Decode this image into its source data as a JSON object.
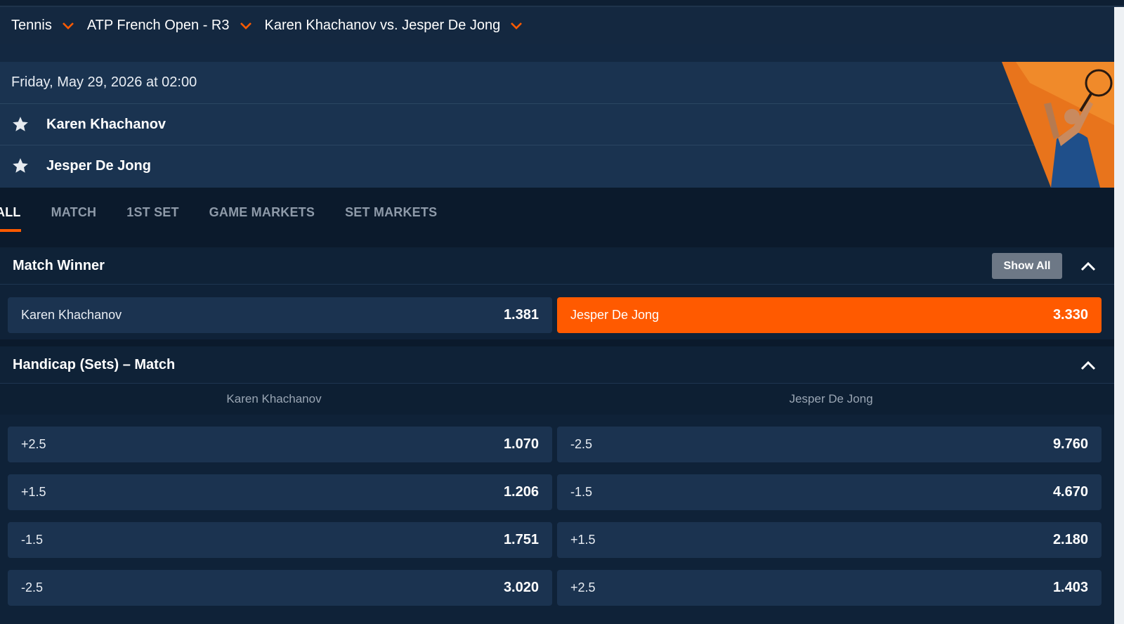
{
  "breadcrumbs": [
    {
      "label": "Tennis"
    },
    {
      "label": "ATP French Open - R3"
    },
    {
      "label": "Karen Khachanov vs. Jesper De Jong"
    }
  ],
  "event": {
    "date": "Friday, May 29, 2026 at 02:00",
    "team1": "Karen Khachanov",
    "team2": "Jesper De Jong"
  },
  "tabs": [
    "ALL",
    "MATCH",
    "1ST SET",
    "GAME MARKETS",
    "SET MARKETS"
  ],
  "match_winner": {
    "title": "Match Winner",
    "show_all": "Show All",
    "options": [
      {
        "label": "Karen Khachanov",
        "odds": "1.381"
      },
      {
        "label": "Jesper De Jong",
        "odds": "3.330"
      }
    ]
  },
  "handicap": {
    "title": "Handicap (Sets) – Match",
    "col1": "Karen Khachanov",
    "col2": "Jesper De Jong",
    "rows": [
      {
        "left_label": "+2.5",
        "left_odds": "1.070",
        "right_label": "-2.5",
        "right_odds": "9.760"
      },
      {
        "left_label": "+1.5",
        "left_odds": "1.206",
        "right_label": "-1.5",
        "right_odds": "4.670"
      },
      {
        "left_label": "-1.5",
        "left_odds": "1.751",
        "right_label": "+1.5",
        "right_odds": "2.180"
      },
      {
        "left_label": "-2.5",
        "left_odds": "3.020",
        "right_label": "+2.5",
        "right_odds": "1.403"
      }
    ]
  },
  "colors": {
    "accent": "#ff5a00",
    "background": "#0b1a2c",
    "button": "#1b3350"
  }
}
